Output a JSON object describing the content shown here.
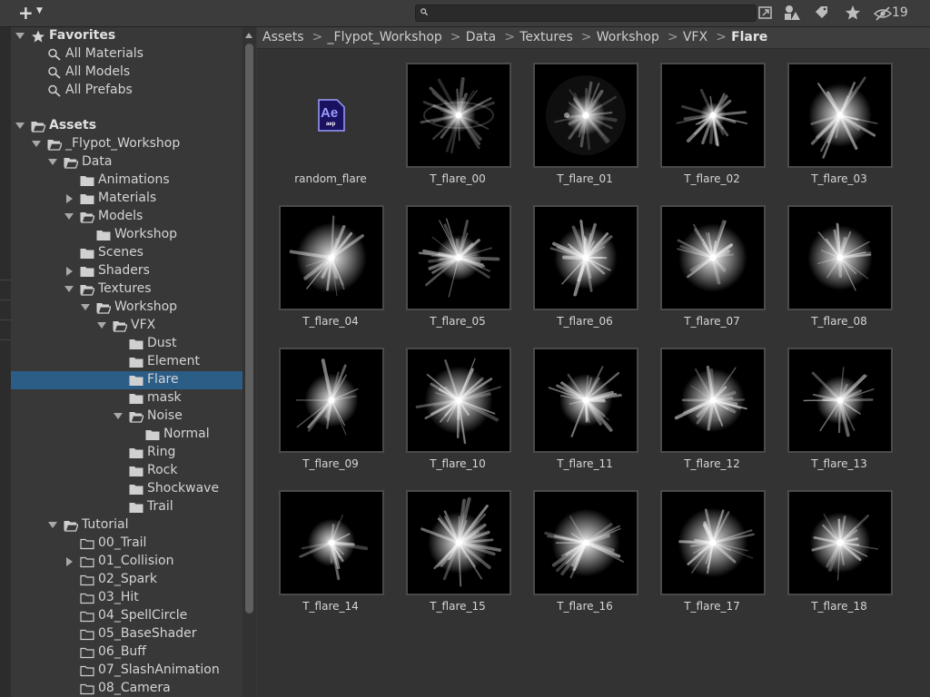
{
  "toolbar": {
    "add_button_icon": "plus-icon",
    "search_value": "",
    "hidden_count": "19"
  },
  "tree": {
    "favorites": {
      "label": "Favorites",
      "items": [
        "All Materials",
        "All Models",
        "All Prefabs"
      ]
    },
    "assets_label": "Assets",
    "project_label": "_Flypot_Workshop",
    "data_label": "Data",
    "animations": "Animations",
    "materials": "Materials",
    "models": "Models",
    "models_workshop": "Workshop",
    "scenes": "Scenes",
    "shaders": "Shaders",
    "textures": "Textures",
    "textures_workshop": "Workshop",
    "vfx": "VFX",
    "vfx_children": [
      "Dust",
      "Element",
      "Flare",
      "mask"
    ],
    "noise": "Noise",
    "noise_normal": "Normal",
    "vfx_children_after": [
      "Ring",
      "Rock",
      "Shockwave",
      "Trail"
    ],
    "tutorial": "Tutorial",
    "tutorial_children": [
      "00_Trail",
      "01_Collision",
      "02_Spark",
      "03_Hit",
      "04_SpellCircle",
      "05_BaseShader",
      "06_Buff",
      "07_SlashAnimation",
      "08_Camera"
    ],
    "selected": "Flare"
  },
  "breadcrumb": [
    "Assets",
    "_Flypot_Workshop",
    "Data",
    "Textures",
    "Workshop",
    "VFX",
    "Flare"
  ],
  "assets": [
    {
      "name": "random_flare",
      "icon": "after-effects-file-icon",
      "icon_text": "Ae",
      "icon_sub": "aep"
    },
    {
      "name": "T_flare_00"
    },
    {
      "name": "T_flare_01"
    },
    {
      "name": "T_flare_02"
    },
    {
      "name": "T_flare_03"
    },
    {
      "name": "T_flare_04"
    },
    {
      "name": "T_flare_05"
    },
    {
      "name": "T_flare_06"
    },
    {
      "name": "T_flare_07"
    },
    {
      "name": "T_flare_08"
    },
    {
      "name": "T_flare_09"
    },
    {
      "name": "T_flare_10"
    },
    {
      "name": "T_flare_11"
    },
    {
      "name": "T_flare_12"
    },
    {
      "name": "T_flare_13"
    },
    {
      "name": "T_flare_14"
    },
    {
      "name": "T_flare_15"
    },
    {
      "name": "T_flare_16"
    },
    {
      "name": "T_flare_17"
    },
    {
      "name": "T_flare_18"
    }
  ],
  "colors": {
    "selection": "#2c5d87",
    "panel": "#383838",
    "grid_bg": "#333333",
    "ae_icon_bg": "#1a1160",
    "ae_icon_fg": "#9a9dff"
  }
}
